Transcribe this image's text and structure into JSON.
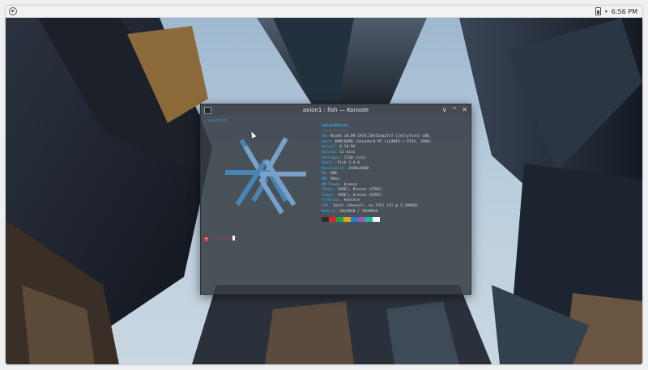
{
  "panel": {
    "launcher_icon": "launcher-icon",
    "battery_icon": "battery-icon",
    "menu_caret": "▾",
    "clock": "6:56 PM"
  },
  "window": {
    "title": "axion1 : fish — Konsole",
    "buttons": {
      "minimize": "∨",
      "maximize": "^",
      "close": "✕"
    }
  },
  "terminal": {
    "prompt": "~ neofetch",
    "info": [
      {
        "key": "",
        "value": "axion1@nixos",
        "user": true
      },
      {
        "key": "",
        "value": "-----------"
      },
      {
        "key": "OS:",
        "value": "NixOS 18.09.1974.58f41ea2fcf (Jellyfish) x86_"
      },
      {
        "key": "Host:",
        "value": "KVM/QEMU (Standard PC (i440FX + PIIX, 1996)"
      },
      {
        "key": "Kernel:",
        "value": "4.14.94"
      },
      {
        "key": "Uptime:",
        "value": "12 mins"
      },
      {
        "key": "Packages:",
        "value": "1150 (nix)"
      },
      {
        "key": "Shell:",
        "value": "fish 3.0.0"
      },
      {
        "key": "Resolution:",
        "value": "1920x1080"
      },
      {
        "key": "DE:",
        "value": "KDE"
      },
      {
        "key": "WM:",
        "value": "KWin"
      },
      {
        "key": "WM Theme:",
        "value": "breeze"
      },
      {
        "key": "Theme:",
        "value": "[KDE], Breeze [GTK2]"
      },
      {
        "key": "Icons:",
        "value": "[KDE], breeze [GTK2]"
      },
      {
        "key": "Terminal:",
        "value": "konsole"
      },
      {
        "key": "CPU:",
        "value": "Intel (Haswell, no TSX) (4) @ 3.399GHz"
      },
      {
        "key": "Memory:",
        "value": "2822MiB / 3949MiB"
      }
    ],
    "swatches": [
      "#2b2f33",
      "#e0242f",
      "#1aa34a",
      "#e8a11b",
      "#1f7fd0",
      "#9b59b6",
      "#1abc9c",
      "#f2f2f2"
    ],
    "command_arrow": "➜",
    "command_path": "~ via nix"
  }
}
